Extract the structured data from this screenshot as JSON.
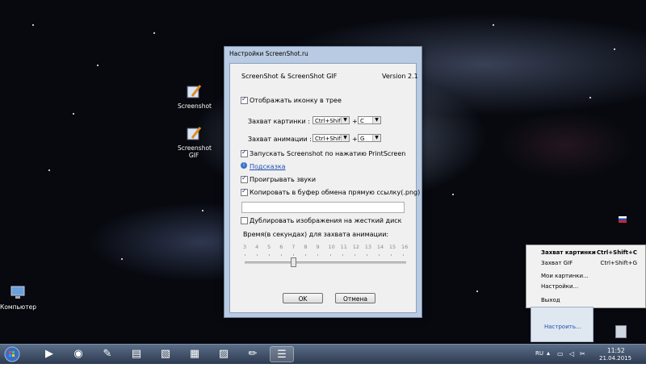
{
  "desktop": {
    "icons": [
      {
        "label": "Screenshot"
      },
      {
        "label": "Screenshot GIF"
      },
      {
        "label": "Компьютер"
      }
    ]
  },
  "dialog": {
    "title": "Настройки ScreenShot.ru",
    "app_name": "ScreenShot & ScreenShot GIF",
    "version": "Version 2.1",
    "show_tray_icon": {
      "label": "Отображать иконку в трее",
      "checked": true
    },
    "capture_picture": {
      "label": "Захват картинки :",
      "modifier": "Ctrl+Shift",
      "plus": "+",
      "key": "C"
    },
    "capture_animation": {
      "label": "Захват анимации :",
      "modifier": "Ctrl+Shift",
      "plus": "+",
      "key": "G"
    },
    "printscreen": {
      "label": "Запускать Screenshot по нажатию PrintScreen",
      "checked": true
    },
    "hint_link": "Подсказка",
    "play_sounds": {
      "label": "Проигрывать звуки",
      "checked": true
    },
    "copy_link": {
      "label": "Копировать в буфер обмена прямую ссылку(.png)",
      "checked": true
    },
    "link_field_value": "",
    "duplicate": {
      "label": "Дублировать изображения на жесткий диск",
      "checked": false
    },
    "time_label": "Время(в секундах) для захвата анимации:",
    "slider_ticks": [
      "3",
      "4",
      "5",
      "6",
      "7",
      "8",
      "9",
      "10",
      "11",
      "12",
      "13",
      "14",
      "15",
      "16"
    ],
    "slider_value": 7,
    "ok_label": "OK",
    "cancel_label": "Отмена"
  },
  "tray_menu": {
    "items": [
      {
        "label": "Захват картинки",
        "shortcut": "Ctrl+Shift+C"
      },
      {
        "label": "Захват GIF",
        "shortcut": "Ctrl+Shift+G"
      },
      {
        "label": "Мои картинки...",
        "shortcut": ""
      },
      {
        "label": "Настройки...",
        "shortcut": ""
      },
      {
        "label": "Выход",
        "shortcut": ""
      }
    ],
    "flyout_label": "Настроить..."
  },
  "taskbar": {
    "language": "RU",
    "time": "11:52",
    "date": "21.04.2015",
    "icons": [
      "start-orb-icon",
      "media-player-icon",
      "browser-icon",
      "tool-icon",
      "archive-icon",
      "notes-icon",
      "calculator-icon",
      "paint-icon",
      "pencil-icon",
      "list-icon"
    ]
  },
  "colors": {
    "link": "#1f4fb4",
    "dialog_frame": "#b9cbe3",
    "taskbar": "#3d4d66"
  }
}
